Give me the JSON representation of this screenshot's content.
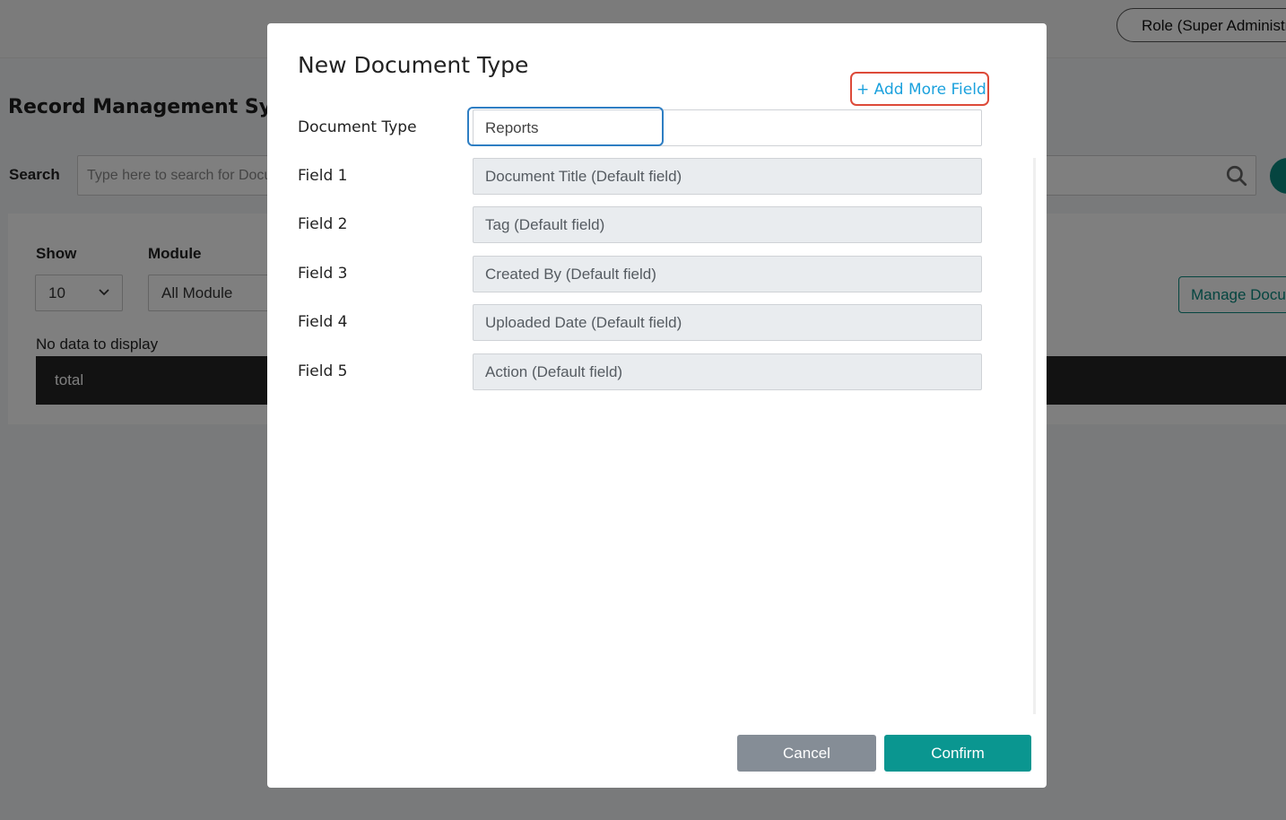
{
  "header": {
    "role_label": "Role (Super Administrator)"
  },
  "page": {
    "title": "Record Management System",
    "search_label": "Search",
    "search_placeholder": "Type here to search for Documents",
    "show_label": "Show",
    "show_value": "10",
    "module_label": "Module",
    "module_value": "All Module",
    "manage_button": "Manage Document Type",
    "no_data": "No data to display",
    "table_column": "total"
  },
  "modal": {
    "title": "New Document Type",
    "add_more_label": "+ Add More Field",
    "document_type_label": "Document Type",
    "document_type_value": "Reports",
    "fields": [
      {
        "label": "Field 1",
        "value": "Document Title (Default field)"
      },
      {
        "label": "Field 2",
        "value": "Tag (Default field)"
      },
      {
        "label": "Field 3",
        "value": "Created By (Default field)"
      },
      {
        "label": "Field 4",
        "value": "Uploaded Date (Default field)"
      },
      {
        "label": "Field 5",
        "value": "Action (Default field)"
      }
    ],
    "cancel_label": "Cancel",
    "confirm_label": "Confirm"
  },
  "colors": {
    "accent": "#0a9690",
    "link": "#1ba1dd",
    "highlight_red": "#dd4a39",
    "focus_blue": "#2e7ec3"
  }
}
